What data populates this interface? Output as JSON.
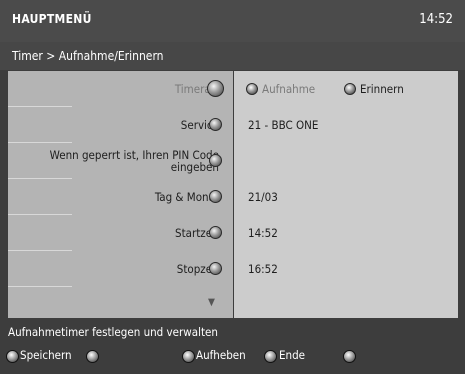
{
  "header": {
    "title": "HAUPTMENÜ",
    "clock": "14:52"
  },
  "breadcrumb": "Timer > Aufnahme/Erinnern",
  "rows": {
    "timerart": {
      "label": "Timerart",
      "options": [
        {
          "label": "Aufnahme",
          "selected": true
        },
        {
          "label": "Erinnern",
          "selected": false
        }
      ]
    },
    "service": {
      "label": "Service",
      "value": "21 - BBC ONE"
    },
    "pin": {
      "label_line1": "Wenn geperrt ist, Ihren PIN Code",
      "label_line2": "eingeben",
      "value": ""
    },
    "tag_monat": {
      "label": "Tag & Monat",
      "value": "21/03"
    },
    "startzeit": {
      "label": "Startzeit",
      "value": "14:52"
    },
    "stopzeit": {
      "label": "Stopzeit",
      "value": "16:52"
    }
  },
  "status_text": "Aufnahmetimer festlegen und verwalten",
  "footer": {
    "save_label": "Speichern",
    "cancel_label": "Aufheben",
    "end_label": "Ende"
  },
  "colors": {
    "background": "#3d3d3d",
    "label_column": "#b4b4b4",
    "value_column": "#cccccc",
    "text_dark": "#1e1e1e",
    "text_dim": "#7a7a7a"
  },
  "icons": {
    "radio": "radio-knob-icon",
    "adjust": "adjust-knob-icon",
    "scroll": "scroll-down-arrow-icon"
  }
}
